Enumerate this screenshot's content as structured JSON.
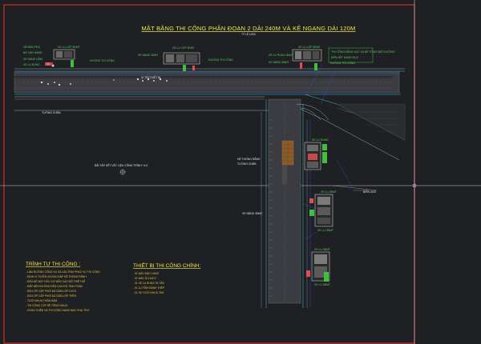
{
  "title": "MẶT BẰNG THI CÔNG PHÂN ĐOẠN 2 DÀI 240M VÀ KÊ NGANG DÀI 120M",
  "scale": "TỶ LỆ 1/200",
  "labels": {
    "top_left_1": "HỆ ĐÈN PHA",
    "top_left_2": "BỐ VẬN HÀNH",
    "top_left_3": "XE NÂNG DẦM",
    "top_left_4": "XE LU RUNG",
    "veh1": "XE LU LỐP 3ĐMT",
    "veh1b": "HƯỚNG THI CÔNG",
    "veh2": "XE LU LỐP 3ĐMT",
    "veh2b": "XE NÂNG 3ĐMT",
    "veh2c": "HƯỚNG THI CÔNG",
    "veh3": "XE LU LỐP 3ĐMT",
    "veh3b": "XE LU RUNG 3ĐMT",
    "veh3c": "XE NÂNG 3ĐMT",
    "veh3d": "HƯỚNG THI CÔNG",
    "note_box_1": "THI CÔNG RÃNH DỌC VÀ BÊ TÔNG MẶT ĐƯỜNG",
    "note_box_2": "ĐẾN HẾT HẠNG MỤC",
    "road_top": "VỊ TRÍ THIẾT BỊ",
    "road_left": "TƯỜNG CHẮN",
    "center_note": "BÃI TẬP KẾT VẬT LIỆU CÔNG TRÌNH +4.0",
    "vr_1": "XE LU RUNG",
    "vr_2": "HỆ THỐNG RÃNH",
    "vr_3": "TƯỜNG CHẮN",
    "vr_4": "XE LU 3ĐMT",
    "vr_5": "XE NÂNG 3ĐMT",
    "vr_6": "XE LU 3ĐMT",
    "vr_7": "BIÊN GIỚI",
    "vr_8": "XE LU 3ĐMT",
    "vr_9": "XE LU 3ĐMT"
  },
  "sequence": {
    "heading": "TRÌNH TỰ THI CÔNG :",
    "items": [
      "- LÀM ĐƯỜNG CÔNG VỤ VÀ LÁN TRẠI PHỤC VỤ THI CÔNG",
      "- ĐỊNH VỊ TUYẾN VÀ ĐÀO ĐẮP HỆ THỐNG RÃNH",
      "- ĐÀO BỎ ĐẤT HỮU CƠ ĐẾN CAO ĐỘ THIẾT KẾ",
      "- ĐẮP NỀN ĐƯỜNG ĐẾN CAO ĐỘ TÍNH TOÁN",
      "- RẢI LỚP CẤP PHỐI ĐÁ DĂM LỚP DƯỚI",
      "- RẢI LỚP CẤP PHỐI ĐÁ DĂM LỚP TRÊN",
      "- TƯỚI NHỰA THẤM BÁM",
      "- THI CÔNG LỚP BÊ TÔNG NHỰA",
      "- HOÀN THIỆN VÀ THI CÔNG HẠNG MỤC PHỤ TRỢ"
    ]
  },
  "equipment": {
    "heading": "THIẾT BỊ THI CÔNG CHÍNH:",
    "items": [
      "- 01 MÁY ĐÀO 0.8M3",
      "- 01 MÁY ỦI 110CV",
      "- 01 XE LU RUNG 25 TẤN",
      "- 01 LU TĨNH BÁNH THÉP",
      "- 01 XE TƯỚI NHỰA 7M3"
    ]
  },
  "colors": {
    "background": "#1f2024",
    "border": "#d03030",
    "road": "#a8a8a8",
    "accent_yellow": "#f0e64a",
    "green": "#3fbf3f",
    "cyan": "#3fc0d0",
    "blue": "#3050e0",
    "brick": "#8a5a2a"
  }
}
